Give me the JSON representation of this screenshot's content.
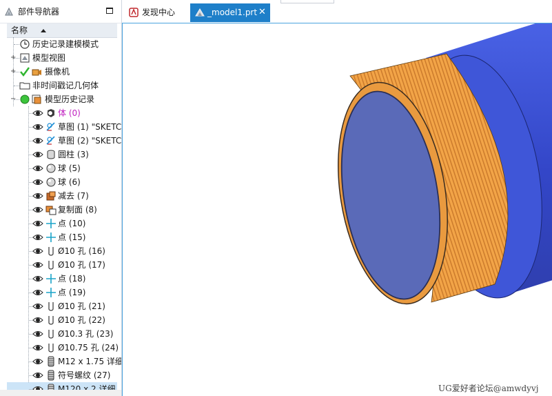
{
  "navigator": {
    "title": "部件导航器",
    "column_header": "名称",
    "items": [
      {
        "label": "历史记录建模模式",
        "icon": "clock-icon"
      },
      {
        "label": "模型视图",
        "icon": "model-view-icon",
        "expand": "+"
      },
      {
        "label": "摄像机",
        "icon": "camera-icon",
        "expand": "+"
      },
      {
        "label": "非时间戳记几何体",
        "icon": "folder-icon"
      },
      {
        "label": "模型历史记录",
        "icon": "history-icon",
        "expand": "−"
      }
    ],
    "features": [
      {
        "label": "体 (0)",
        "icon": "body-icon"
      },
      {
        "label": "草图 (1) \"SKETC",
        "icon": "sketch-icon"
      },
      {
        "label": "草图 (2) \"SKETC",
        "icon": "sketch-icon"
      },
      {
        "label": "圆柱 (3)",
        "icon": "cylinder-icon"
      },
      {
        "label": "球 (5)",
        "icon": "sphere-icon"
      },
      {
        "label": "球 (6)",
        "icon": "sphere-icon"
      },
      {
        "label": "减去 (7)",
        "icon": "subtract-icon"
      },
      {
        "label": "复制面 (8)",
        "icon": "copy-face-icon"
      },
      {
        "label": "点 (10)",
        "icon": "point-icon"
      },
      {
        "label": "点 (15)",
        "icon": "point-icon"
      },
      {
        "label": "Ø10 孔 (16)",
        "icon": "hole-icon"
      },
      {
        "label": "Ø10 孔 (17)",
        "icon": "hole-icon"
      },
      {
        "label": "点 (18)",
        "icon": "point-icon"
      },
      {
        "label": "点 (19)",
        "icon": "point-icon"
      },
      {
        "label": "Ø10 孔 (21)",
        "icon": "hole-icon"
      },
      {
        "label": "Ø10 孔 (22)",
        "icon": "hole-icon"
      },
      {
        "label": "Ø10.3 孔 (23)",
        "icon": "hole-icon"
      },
      {
        "label": "Ø10.75 孔 (24)",
        "icon": "hole-icon"
      },
      {
        "label": "M12 x 1.75 详细",
        "icon": "thread-icon"
      },
      {
        "label": "符号螺纹 (27)",
        "icon": "thread-icon"
      },
      {
        "label": "M120 x 2 详细",
        "icon": "thread-icon"
      }
    ]
  },
  "tabs": [
    {
      "label": "发现中心",
      "icon": "discovery-icon"
    },
    {
      "label": "_model1.prt",
      "icon": "part-icon",
      "close": "✕",
      "active": true
    }
  ],
  "watermark": "UG爱好者论坛@amwdyvj",
  "colors": {
    "tab_active": "#1e7fc9",
    "cylinder_blue": "#3a4fd0",
    "end_face": "#5a6ab8",
    "thread_orange": "#f0a040"
  }
}
